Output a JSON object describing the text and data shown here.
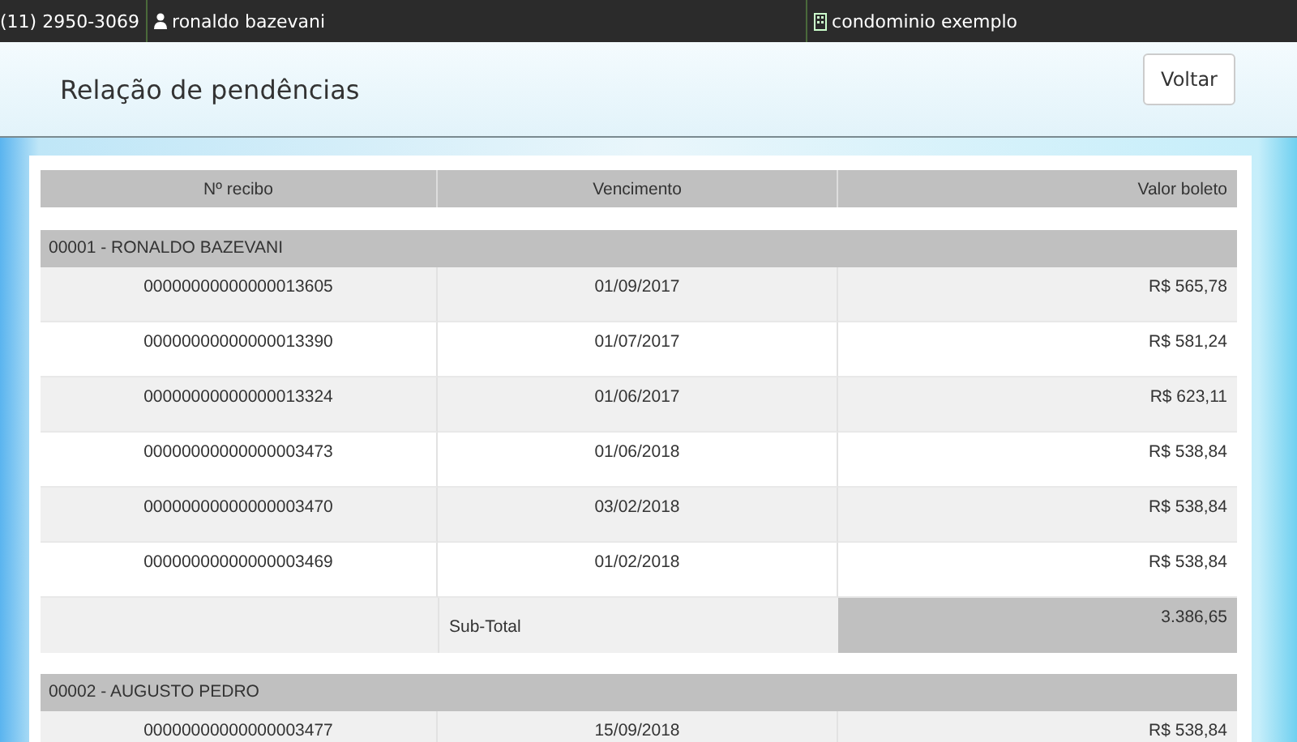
{
  "top_bar": {
    "phone": "(11) 2950-3069",
    "user": "ronaldo bazevani",
    "condominium": "condominio exemplo"
  },
  "header": {
    "title": "Relação de pendências",
    "back_button": "Voltar"
  },
  "table": {
    "columns": [
      "Nº recibo",
      "Vencimento",
      "Valor boleto"
    ],
    "groups": [
      {
        "title": "00001 - RONALDO BAZEVANI",
        "rows": [
          {
            "receipt": "00000000000000013605",
            "due": "01/09/2017",
            "amount": "R$ 565,78"
          },
          {
            "receipt": "00000000000000013390",
            "due": "01/07/2017",
            "amount": "R$ 581,24"
          },
          {
            "receipt": "00000000000000013324",
            "due": "01/06/2017",
            "amount": "R$ 623,11"
          },
          {
            "receipt": "00000000000000003473",
            "due": "01/06/2018",
            "amount": "R$ 538,84"
          },
          {
            "receipt": "00000000000000003470",
            "due": "03/02/2018",
            "amount": "R$ 538,84"
          },
          {
            "receipt": "00000000000000003469",
            "due": "01/02/2018",
            "amount": "R$ 538,84"
          }
        ],
        "subtotal_label": "Sub-Total",
        "subtotal": "3.386,65"
      },
      {
        "title": "00002 - AUGUSTO PEDRO",
        "rows": [
          {
            "receipt": "00000000000000003477",
            "due": "15/09/2018",
            "amount": "R$ 538,84"
          }
        ]
      }
    ]
  }
}
